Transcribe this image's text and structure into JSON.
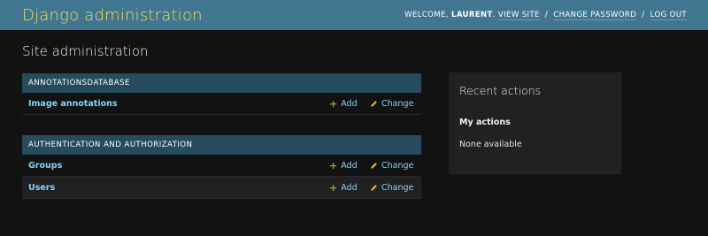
{
  "header": {
    "branding": "Django administration",
    "welcome": "WELCOME,",
    "username": "LAURENT",
    "view_site": "VIEW SITE",
    "change_password": "CHANGE PASSWORD",
    "log_out": "LOG OUT",
    "separator": "/"
  },
  "page": {
    "title": "Site administration"
  },
  "apps": [
    {
      "caption": "ANNOTATIONSDATABASE",
      "models": [
        {
          "name": "Image annotations",
          "add": "Add",
          "change": "Change"
        }
      ]
    },
    {
      "caption": "AUTHENTICATION AND AUTHORIZATION",
      "models": [
        {
          "name": "Groups",
          "add": "Add",
          "change": "Change"
        },
        {
          "name": "Users",
          "add": "Add",
          "change": "Change"
        }
      ]
    }
  ],
  "recent_actions": {
    "title": "Recent actions",
    "subtitle": "My actions",
    "empty_text": "None available"
  },
  "colors": {
    "header_bg": "#417690",
    "branding": "#f5dd5d",
    "caption_bg": "#264b5d",
    "link": "#81d4fa",
    "add_icon": "#70bf2b",
    "change_icon": "#efb80b",
    "page_bg": "#121212"
  },
  "icons": {
    "add": "plus-icon",
    "change": "pencil-icon"
  }
}
